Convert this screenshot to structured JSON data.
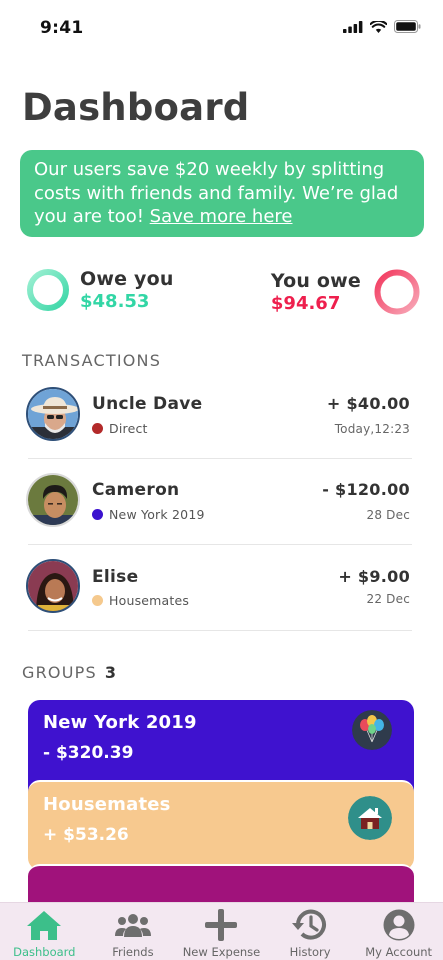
{
  "status": {
    "time": "9:41"
  },
  "page": {
    "title": "Dashboard"
  },
  "promo": {
    "text": "Our users save $20 weekly by splitting costs with friends and family. We’re glad you are too! ",
    "link": "Save more here"
  },
  "balances": {
    "owe_you": {
      "label": "Owe you",
      "amount": "$48.53",
      "color": "#32d6a5"
    },
    "you_owe": {
      "label": "You owe",
      "amount": "$94.67",
      "color": "#ee1f4d"
    }
  },
  "transactions": {
    "heading": "TRANSACTIONS",
    "items": [
      {
        "name": "Uncle Dave",
        "group": "Direct",
        "group_color": "#b32a2a",
        "amount": "+ $40.00",
        "date": "Today,12:23"
      },
      {
        "name": "Cameron",
        "group": "New York 2019",
        "group_color": "#3b12cf",
        "amount": "- $120.00",
        "date": "28 Dec"
      },
      {
        "name": "Elise",
        "group": "Housemates",
        "group_color": "#f5c98d",
        "amount": "+ $9.00",
        "date": "22 Dec"
      }
    ]
  },
  "groups": {
    "heading": "GROUPS",
    "count": "3",
    "items": [
      {
        "name": "New York 2019",
        "amount": "- $320.39",
        "color": "#3f12cf",
        "icon": "balloons-icon"
      },
      {
        "name": "Housemates",
        "amount": "+ $53.26",
        "color": "#f7c98f",
        "icon": "house-icon"
      },
      {
        "name": "",
        "amount": "",
        "color": "#a0127b",
        "icon": ""
      }
    ]
  },
  "tabs": [
    {
      "label": "Dashboard",
      "icon": "home-icon",
      "active": true
    },
    {
      "label": "Friends",
      "icon": "people-icon"
    },
    {
      "label": "New Expense",
      "icon": "plus-icon"
    },
    {
      "label": "History",
      "icon": "history-icon"
    },
    {
      "label": "My Account",
      "icon": "account-icon"
    }
  ]
}
